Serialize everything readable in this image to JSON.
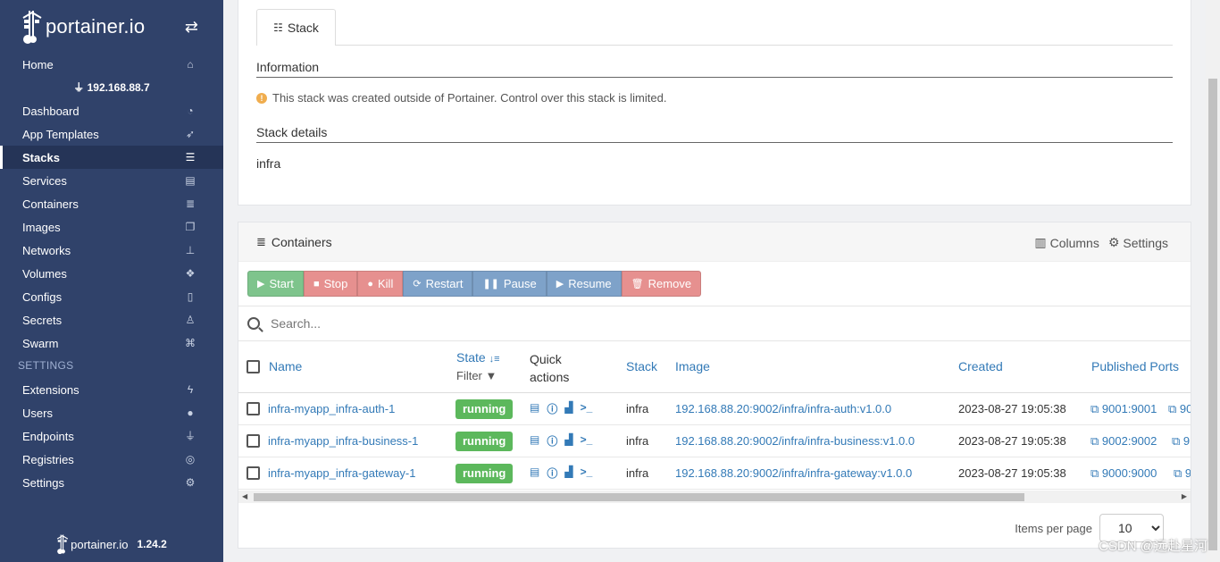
{
  "app": {
    "logo_text": "portainer.io",
    "footer_logo_text": "portainer.io",
    "version": "1.24.2"
  },
  "sidebar": {
    "endpoint": "192.168.88.7",
    "settings_section": "SETTINGS",
    "items": [
      {
        "label": "Home",
        "icon": "home-icon"
      },
      {
        "label": "Dashboard",
        "icon": "tachometer-icon"
      },
      {
        "label": "App Templates",
        "icon": "rocket-icon"
      },
      {
        "label": "Stacks",
        "icon": "th-list-icon"
      },
      {
        "label": "Services",
        "icon": "list-alt-icon"
      },
      {
        "label": "Containers",
        "icon": "server-icon"
      },
      {
        "label": "Images",
        "icon": "clone-icon"
      },
      {
        "label": "Networks",
        "icon": "sitemap-icon"
      },
      {
        "label": "Volumes",
        "icon": "cubes-icon"
      },
      {
        "label": "Configs",
        "icon": "file-code-icon"
      },
      {
        "label": "Secrets",
        "icon": "user-secret-icon"
      },
      {
        "label": "Swarm",
        "icon": "object-group-icon"
      },
      {
        "label": "Extensions",
        "icon": "bolt-icon"
      },
      {
        "label": "Users",
        "icon": "users-icon"
      },
      {
        "label": "Endpoints",
        "icon": "plug-icon"
      },
      {
        "label": "Registries",
        "icon": "database-icon"
      },
      {
        "label": "Settings",
        "icon": "cogs-icon"
      }
    ]
  },
  "stack": {
    "tab_label": "Stack",
    "information_title": "Information",
    "info_message": "This stack was created outside of Portainer. Control over this stack is limited.",
    "details_title": "Stack details",
    "name": "infra"
  },
  "containers": {
    "title": "Containers",
    "columns_label": "Columns",
    "settings_label": "Settings",
    "buttons": {
      "start": "Start",
      "stop": "Stop",
      "kill": "Kill",
      "restart": "Restart",
      "pause": "Pause",
      "resume": "Resume",
      "remove": "Remove"
    },
    "search_placeholder": "Search...",
    "headers": {
      "name": "Name",
      "state": "State",
      "filter": "Filter",
      "quick_actions": "Quick actions",
      "stack": "Stack",
      "image": "Image",
      "created": "Created",
      "published_ports": "Published Ports"
    },
    "rows": [
      {
        "name": "infra-myapp_infra-auth-1",
        "state": "running",
        "stack": "infra",
        "image": "192.168.88.20:9002/infra/infra-auth:v1.0.0",
        "created": "2023-08-27 19:05:38",
        "port": "9001:9001",
        "port_more": "90"
      },
      {
        "name": "infra-myapp_infra-business-1",
        "state": "running",
        "stack": "infra",
        "image": "192.168.88.20:9002/infra/infra-business:v1.0.0",
        "created": "2023-08-27 19:05:38",
        "port": "9002:9002",
        "port_more": "9"
      },
      {
        "name": "infra-myapp_infra-gateway-1",
        "state": "running",
        "stack": "infra",
        "image": "192.168.88.20:9002/infra/infra-gateway:v1.0.0",
        "created": "2023-08-27 19:05:38",
        "port": "9000:9000",
        "port_more": "9"
      }
    ],
    "items_per_page_label": "Items per page",
    "items_per_page_value": "10"
  },
  "watermark": "CSDN @远赴星河",
  "colors": {
    "sidebar_bg": "#30426a",
    "link": "#337ab7",
    "running": "#5cb85c"
  }
}
